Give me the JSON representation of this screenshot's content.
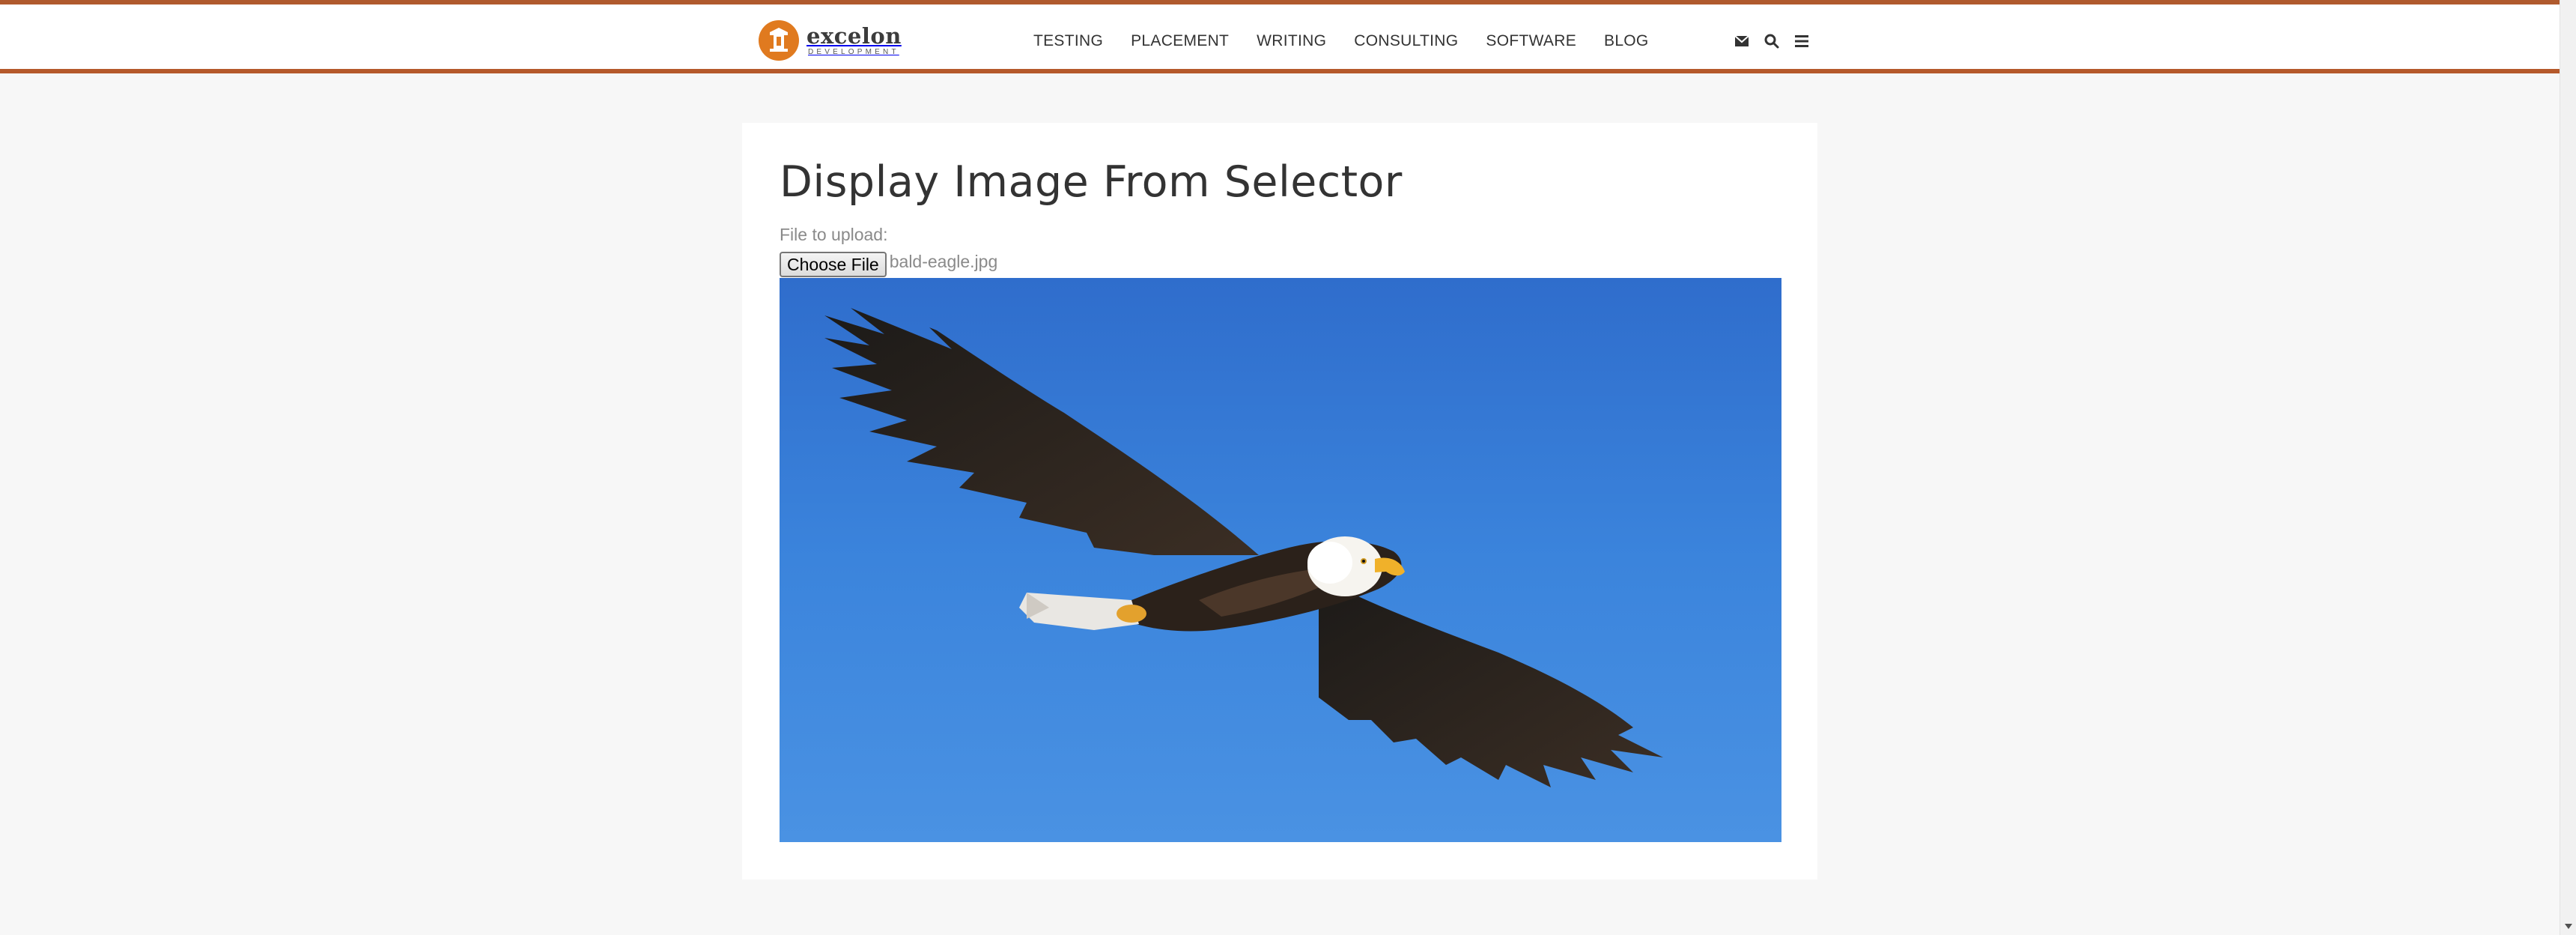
{
  "brand": {
    "name": "excelon",
    "subtitle": "DEVELOPMENT",
    "accent_color": "#b5592b",
    "logo_color": "#e07a1f"
  },
  "nav": {
    "items": [
      "TESTING",
      "PLACEMENT",
      "WRITING",
      "CONSULTING",
      "SOFTWARE",
      "BLOG"
    ],
    "icons": [
      "envelope-icon",
      "search-icon",
      "menu-icon"
    ]
  },
  "page": {
    "title": "Display Image From Selector",
    "upload_label": "File to upload:",
    "choose_button": "Choose File",
    "file_name": "bald-eagle.jpg"
  },
  "preview": {
    "subject": "bald-eagle-photo",
    "sky_color": "#3a82dc"
  }
}
